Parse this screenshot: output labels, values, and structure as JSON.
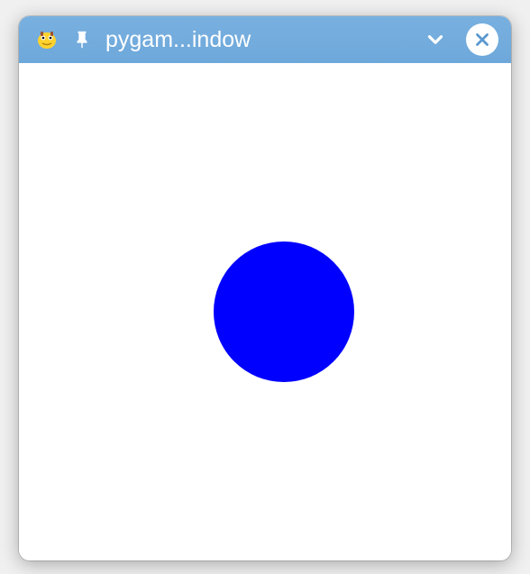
{
  "window": {
    "title": "pygam...indow"
  },
  "icons": {
    "app": "pygame-snake-icon",
    "pin": "pin-icon",
    "chevron": "chevron-down-icon",
    "close": "close-icon"
  },
  "canvas": {
    "circle_color": "#0000ff",
    "background_color": "#ffffff"
  }
}
